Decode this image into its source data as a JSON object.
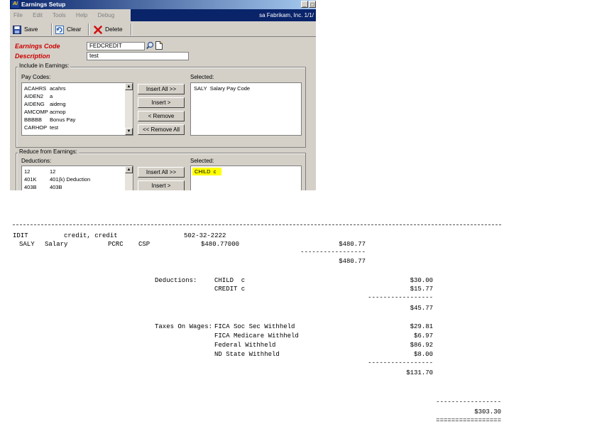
{
  "window": {
    "title": "Earnings Setup",
    "app_icon": "Ai",
    "controls": [
      "_",
      "□"
    ]
  },
  "menu": {
    "items": [
      "File",
      "Edit",
      "Tools",
      "Help",
      "Debug"
    ],
    "company": "sa  Fabrikam, Inc.  1/1/"
  },
  "toolbar": {
    "save": "Save",
    "clear": "Clear",
    "delete": "Delete"
  },
  "form": {
    "earnings_code_label": "Earnings Code",
    "earnings_code_value": "FEDCREDIT",
    "description_label": "Description",
    "description_value": "test"
  },
  "include_group": {
    "title": "Include in Earnings:",
    "pay_codes_label": "Pay Codes:",
    "selected_label": "Selected:",
    "pay_codes": [
      {
        "code": "ACAHRS",
        "desc": "acahrs"
      },
      {
        "code": "AIDEN2",
        "desc": "a"
      },
      {
        "code": "AIDENG",
        "desc": "aideng"
      },
      {
        "code": "AMCOMP",
        "desc": "acmop"
      },
      {
        "code": "BBBBB",
        "desc": "Bonus Pay"
      },
      {
        "code": "CARHOP",
        "desc": "test"
      }
    ],
    "selected": [
      {
        "code": "SALY",
        "desc": "Salary Pay Code"
      }
    ],
    "buttons": [
      "Insert All >>",
      "Insert >",
      "< Remove",
      "<< Remove All"
    ]
  },
  "reduce_group": {
    "title": "Reduce from Earnings:",
    "deductions_label": "Deductions:",
    "selected_label": "Selected:",
    "deductions": [
      {
        "code": "12",
        "desc": "12"
      },
      {
        "code": "401K",
        "desc": "401(k) Deduction"
      },
      {
        "code": "403B",
        "desc": "403B"
      }
    ],
    "selected": [
      {
        "code": "CHILD",
        "desc": "c"
      }
    ],
    "buttons": [
      "Insert All >>",
      "Insert >"
    ],
    "highlight_color": "#ffff00"
  },
  "report": {
    "employee_line": {
      "id": "IDIT",
      "name": "credit, credit",
      "ssn": "502-32-2222"
    },
    "pay_line": {
      "code": "SALY",
      "desc": "Salary",
      "type": "PCRC",
      "dept": "CSP",
      "rate": "$480.77000",
      "amount": "$480.77"
    },
    "pay_subtotal_rule": "-----------------",
    "pay_subtotal": "$480.77",
    "deductions_label": "Deductions:",
    "deductions": [
      {
        "name": "CHILD  c",
        "amount": "$30.00"
      },
      {
        "name": "CREDIT c",
        "amount": "$15.77"
      }
    ],
    "deductions_rule": "-----------------",
    "deductions_total": "$45.77",
    "taxes_label": "Taxes On Wages:",
    "taxes": [
      {
        "name": "FICA Soc Sec Withheld",
        "amount": "$29.81"
      },
      {
        "name": "FICA Medicare Withheld",
        "amount": "$6.97"
      },
      {
        "name": "Federal Withheld",
        "amount": "$86.92"
      },
      {
        "name": "ND State Withheld",
        "amount": "$8.00"
      }
    ],
    "taxes_rule": "-----------------",
    "taxes_total": "$131.70",
    "final_rule": "-----------------",
    "final_total": "$303.30",
    "final_double_rule": "================="
  }
}
